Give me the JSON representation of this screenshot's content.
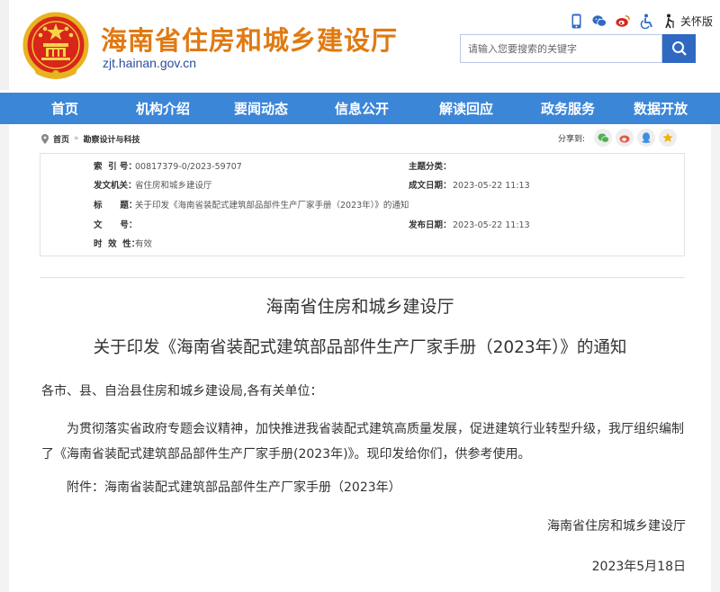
{
  "header": {
    "site_title": "海南省住房和城乡建设厅",
    "site_domain": "zjt.hainan.gov.cn",
    "care_label": "关怀版",
    "search_placeholder": "请输入您要搜索的关键字"
  },
  "top_icons": [
    "phone-icon",
    "wechat-icon",
    "weibo-icon",
    "accessibility-icon",
    "elderly-care-icon"
  ],
  "nav": {
    "items": [
      "首页",
      "机构介绍",
      "要闻动态",
      "信息公开",
      "解读回应",
      "政务服务",
      "数据开放"
    ]
  },
  "breadcrumb": {
    "home": "首页",
    "separator": "»",
    "current": "勘察设计与科技"
  },
  "share": {
    "label": "分享到:",
    "icons": [
      "wechat-icon",
      "weibo-icon",
      "qq-icon",
      "qzone-icon"
    ]
  },
  "meta": {
    "index_key": "索  引 号：",
    "index_val": "00817379-0/2023-59707",
    "topic_key": "主题分类：",
    "topic_val": "",
    "issuer_key": "发文机关：",
    "issuer_val": "省住房和城乡建设厅",
    "created_key": "成文日期：",
    "created_val": "2023-05-22 11:13",
    "title_key": "标      题：",
    "title_val": "关于印发《海南省装配式建筑部品部件生产厂家手册（2023年）》的通知",
    "docno_key": "文      号：",
    "docno_val": "",
    "published_key": "发布日期：",
    "published_val": "2023-05-22 11:13",
    "validity_key": "时  效  性：",
    "validity_val": "有效"
  },
  "article": {
    "org": "海南省住房和城乡建设厅",
    "title": "关于印发《海南省装配式建筑部品部件生产厂家手册（2023年）》的通知",
    "salutation": "各市、县、自治县住房和城乡建设局,各有关单位：",
    "body": "为贯彻落实省政府专题会议精神，加快推进我省装配式建筑高质量发展，促进建筑行业转型升级，我厅组织编制了《海南省装配式建筑部品部件生产厂家手册(2023年)》。现印发给你们，供参考使用。",
    "attachment": "附件：海南省装配式建筑部品部件生产厂家手册（2023年）",
    "signature": "海南省住房和城乡建设厅",
    "date": "2023年5月18日"
  },
  "colors": {
    "nav_bg": "#3c86d8",
    "title_orange": "#e07a12",
    "search_btn": "#2f69c2"
  }
}
